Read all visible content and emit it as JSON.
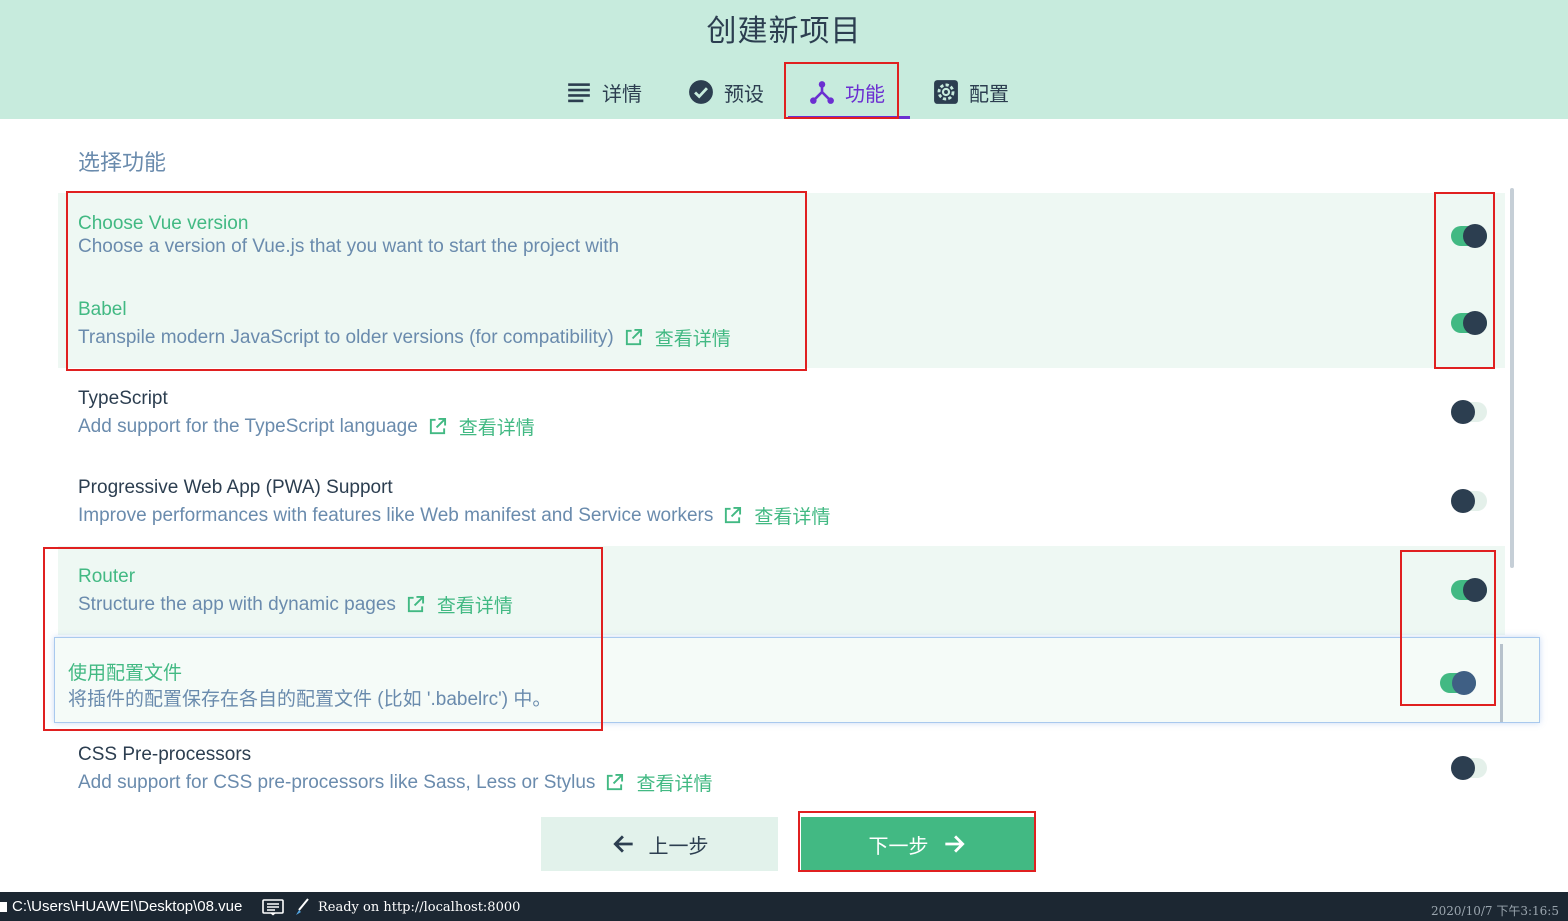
{
  "header": {
    "title": "创建新项目",
    "tabs": [
      {
        "label": "详情",
        "icon": "list-icon"
      },
      {
        "label": "预设",
        "icon": "check-circle-icon"
      },
      {
        "label": "功能",
        "icon": "fork-icon",
        "active": true
      },
      {
        "label": "配置",
        "icon": "gear-icon"
      }
    ]
  },
  "main": {
    "section_title": "选择功能",
    "features": [
      {
        "title": "Choose Vue version",
        "description": "Choose a version of Vue.js that you want to start the project with",
        "enabled": true
      },
      {
        "title": "Babel",
        "description": "Transpile modern JavaScript to older versions (for compatibility)",
        "link": "查看详情",
        "enabled": true
      },
      {
        "title": "TypeScript",
        "description": "Add support for the TypeScript language",
        "link": "查看详情",
        "enabled": false
      },
      {
        "title": "Progressive Web App (PWA) Support",
        "description": "Improve performances with features like Web manifest and Service workers",
        "link": "查看详情",
        "enabled": false
      },
      {
        "title": "Router",
        "description": "Structure the app with dynamic pages",
        "link": "查看详情",
        "enabled": true
      },
      {
        "title": "CSS Pre-processors",
        "description": "Add support for CSS pre-processors like Sass, Less or Stylus",
        "link": "查看详情",
        "enabled": false
      }
    ],
    "config_option": {
      "title": "使用配置文件",
      "description": "将插件的配置保存在各自的配置文件 (比如 '.babelrc') 中。",
      "enabled": true
    }
  },
  "footer": {
    "prev_label": "上一步",
    "next_label": "下一步"
  },
  "statusbar": {
    "path": "C:\\Users\\HUAWEI\\Desktop\\08.vue",
    "status": "Ready on http://localhost:8000",
    "datetime": "2020/10/7 下午3:16:5"
  },
  "colors": {
    "accent": "#42b983",
    "active_tab": "#6b2fd1",
    "header_bg": "#c7ebdd",
    "highlight_box": "#e02020"
  }
}
